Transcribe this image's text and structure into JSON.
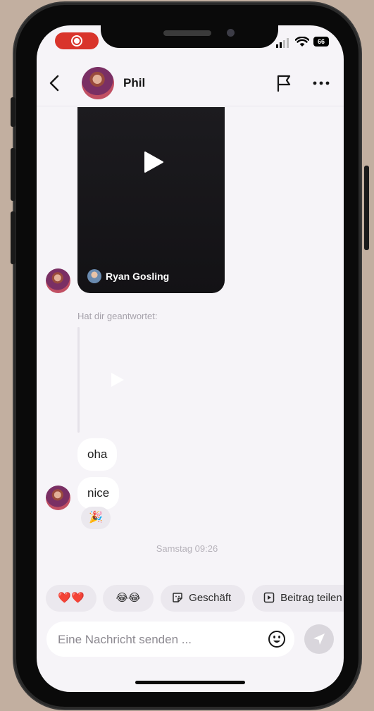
{
  "status_bar": {
    "battery": "66"
  },
  "header": {
    "contact_name": "Phil"
  },
  "messages": {
    "video_author": "Ryan Gosling",
    "reply_label": "Hat dir geantwortet:",
    "bubble_1": "oha",
    "bubble_2": "nice",
    "reaction": "🎉",
    "timestamp": "Samstag 09:26"
  },
  "quick_replies": [
    {
      "label": "❤️❤️",
      "icon": "hearts"
    },
    {
      "label": "😂😂",
      "icon": "laughing-faces"
    },
    {
      "label": "Geschäft",
      "icon": "sticker-icon"
    },
    {
      "label": "Beitrag teilen",
      "icon": "play-square-icon"
    }
  ],
  "composer": {
    "placeholder": "Eine Nachricht senden ..."
  },
  "colors": {
    "accent_red": "#d9342b",
    "background": "#c2afa0",
    "screen": "#f6f4f8"
  }
}
